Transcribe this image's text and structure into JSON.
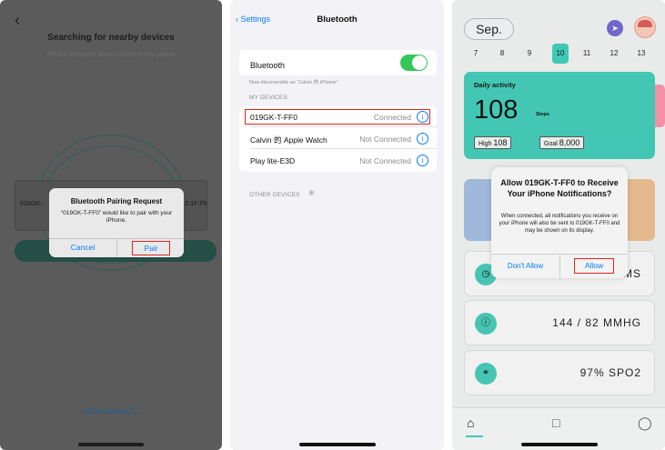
{
  "panel1": {
    "title": "Searching for nearby devices",
    "subtitle": "Please keep the device close to the phone",
    "device_left": "019GK-",
    "device_right": "3:1F:F0",
    "alert": {
      "title": "Bluetooth Pairing Request",
      "message": "“019GK-T-FF0” would like to pair with your iPhone.",
      "cancel": "Cancel",
      "pair": "Pair"
    },
    "link": "Device not found ?"
  },
  "panel2": {
    "back": "Settings",
    "title": "Bluetooth",
    "bluetooth_label": "Bluetooth",
    "bluetooth_on": true,
    "discoverable": "Now discoverable as “Calvin 的 iPhone”.",
    "my_devices_header": "MY DEVICES",
    "devices": [
      {
        "name": "019GK-T-FF0",
        "status": "Connected"
      },
      {
        "name": "Calvin 的 Apple Watch",
        "status": "Not Connected"
      },
      {
        "name": "Play lite-E3D",
        "status": "Not Connected"
      }
    ],
    "other_devices_header": "OTHER DEVICES"
  },
  "panel3": {
    "month": "Sep.",
    "days": [
      "7",
      "8",
      "9",
      "10",
      "11",
      "12",
      "13"
    ],
    "selected_day": "10",
    "activity": {
      "label": "Daily activity",
      "steps": "108",
      "unit": "Steps",
      "high_label": "High",
      "high_value": "108",
      "goal_label": "Goal",
      "goal_value": "8,000"
    },
    "alert": {
      "title": "Allow 019GK-T-FF0 to Receive Your iPhone Notifications?",
      "message": "When connected, all notifications you receive on your iPhone will also be sent to 019GK-T-FF0 and may be shown on its display.",
      "deny": "Don't Allow",
      "allow": "Allow"
    },
    "stats": [
      {
        "value": "MS"
      },
      {
        "value": "144 / 82  MMHG"
      },
      {
        "value": "97%  SPO2"
      }
    ],
    "colors": {
      "accent": "#43c7b4",
      "pink": "#f290a8",
      "ios_blue": "#0a7aff",
      "highlight": "#e0261e"
    }
  }
}
